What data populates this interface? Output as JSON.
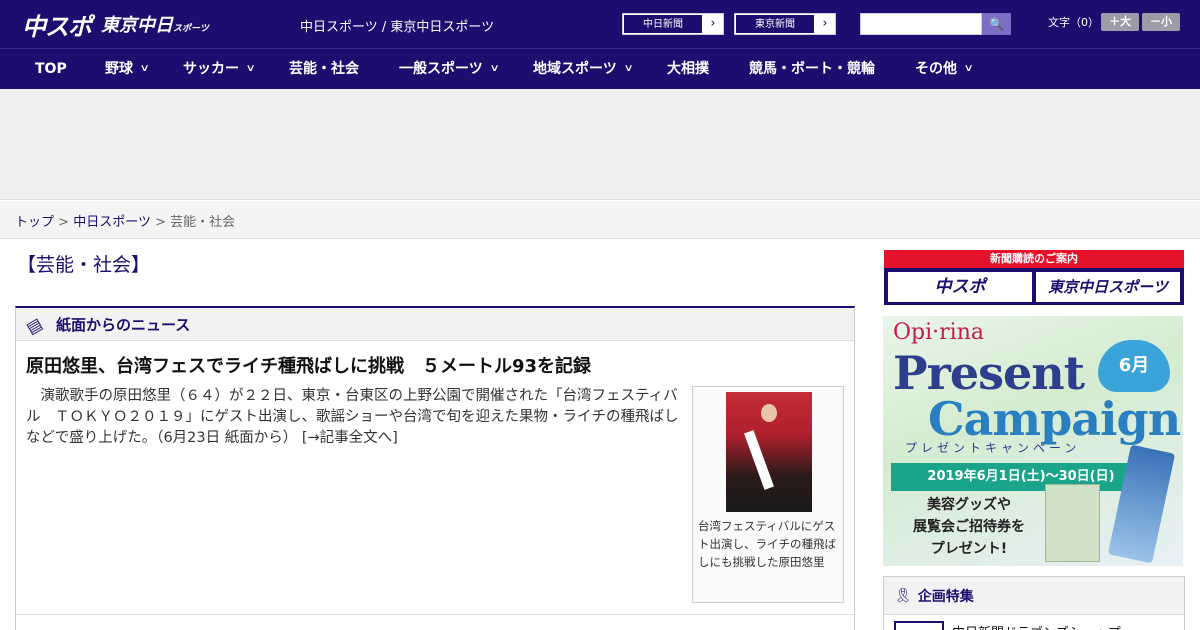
{
  "header": {
    "logo_main": "中スポ",
    "logo_tokyo": "東京中日",
    "logo_tokyo_small": "スポーツ",
    "site_title": "中日スポーツ / 東京中日スポーツ",
    "links": [
      {
        "label": "中日新聞"
      },
      {
        "label": "東京新聞"
      }
    ],
    "search": {
      "placeholder": "",
      "button_icon": "search-icon"
    },
    "font_size_label": "文字（0）",
    "font_larger": "＋大",
    "font_smaller": "－小"
  },
  "nav": {
    "items": [
      {
        "label": "TOP",
        "dropdown": false
      },
      {
        "label": "野球",
        "dropdown": true
      },
      {
        "label": "サッカー",
        "dropdown": true
      },
      {
        "label": "芸能・社会",
        "dropdown": false
      },
      {
        "label": "一般スポーツ",
        "dropdown": true
      },
      {
        "label": "地域スポーツ",
        "dropdown": true
      },
      {
        "label": "大相撲",
        "dropdown": false
      },
      {
        "label": "競馬・ボート・競輪",
        "dropdown": false
      },
      {
        "label": "その他",
        "dropdown": true
      }
    ]
  },
  "breadcrumb": {
    "home": "トップ",
    "sep": ">",
    "section": "中日スポーツ",
    "current": "芸能・社会"
  },
  "category_title": "【芸能・社会】",
  "news": {
    "section_title": "紙面からのニュース",
    "headline": "原田悠里、台湾フェスでライチ種飛ばしに挑戦　５メートル93を記録",
    "body": "演歌歌手の原田悠里（６４）が２２日、東京・台東区の上野公園で開催された「台湾フェスティバル　ＴＯＫＹＯ２０１９」にゲスト出演し、歌謡ショーや台湾で旬を迎えた果物・ライチの種飛ばしなどで盛り上げた。（6月23日 紙面から）",
    "more_link": "[→記事全文へ]",
    "photo_caption": "台湾フェスティバルにゲスト出演し、ライチの種飛ばしにも挑戦した原田悠里"
  },
  "sidebar": {
    "subscribe": {
      "title": "新聞購読のご案内",
      "btn1": "中スポ",
      "btn2": "東京中日スポーツ"
    },
    "banner": {
      "brand": "Opi·rina",
      "line1": "Present",
      "line2": "Campaign",
      "month": "6月",
      "subtitle": "プレゼントキャンペーン",
      "dates": "2019年6月1日(土)～30日(日)",
      "gift_line1": "美容グッズや",
      "gift_line2": "展覧会ご招待券を",
      "gift_line3": "プレゼント!"
    },
    "tokushu": {
      "title": "企画特集",
      "item": "中日新聞ドラゴンズショップ"
    }
  },
  "colors": {
    "brand_navy": "#1c0e6e",
    "accent_red": "#e5122c"
  }
}
